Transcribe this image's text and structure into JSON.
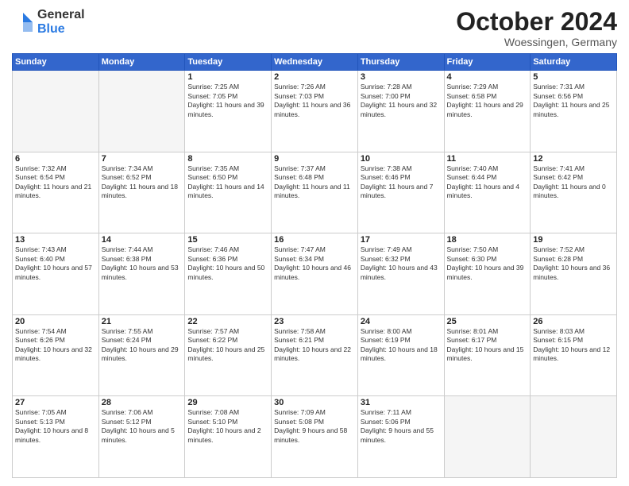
{
  "header": {
    "logo_general": "General",
    "logo_blue": "Blue",
    "month_title": "October 2024",
    "location": "Woessingen, Germany"
  },
  "weekdays": [
    "Sunday",
    "Monday",
    "Tuesday",
    "Wednesday",
    "Thursday",
    "Friday",
    "Saturday"
  ],
  "weeks": [
    [
      {
        "day": "",
        "empty": true
      },
      {
        "day": "",
        "empty": true
      },
      {
        "day": "1",
        "sunrise": "Sunrise: 7:25 AM",
        "sunset": "Sunset: 7:05 PM",
        "daylight": "Daylight: 11 hours and 39 minutes."
      },
      {
        "day": "2",
        "sunrise": "Sunrise: 7:26 AM",
        "sunset": "Sunset: 7:03 PM",
        "daylight": "Daylight: 11 hours and 36 minutes."
      },
      {
        "day": "3",
        "sunrise": "Sunrise: 7:28 AM",
        "sunset": "Sunset: 7:00 PM",
        "daylight": "Daylight: 11 hours and 32 minutes."
      },
      {
        "day": "4",
        "sunrise": "Sunrise: 7:29 AM",
        "sunset": "Sunset: 6:58 PM",
        "daylight": "Daylight: 11 hours and 29 minutes."
      },
      {
        "day": "5",
        "sunrise": "Sunrise: 7:31 AM",
        "sunset": "Sunset: 6:56 PM",
        "daylight": "Daylight: 11 hours and 25 minutes."
      }
    ],
    [
      {
        "day": "6",
        "sunrise": "Sunrise: 7:32 AM",
        "sunset": "Sunset: 6:54 PM",
        "daylight": "Daylight: 11 hours and 21 minutes."
      },
      {
        "day": "7",
        "sunrise": "Sunrise: 7:34 AM",
        "sunset": "Sunset: 6:52 PM",
        "daylight": "Daylight: 11 hours and 18 minutes."
      },
      {
        "day": "8",
        "sunrise": "Sunrise: 7:35 AM",
        "sunset": "Sunset: 6:50 PM",
        "daylight": "Daylight: 11 hours and 14 minutes."
      },
      {
        "day": "9",
        "sunrise": "Sunrise: 7:37 AM",
        "sunset": "Sunset: 6:48 PM",
        "daylight": "Daylight: 11 hours and 11 minutes."
      },
      {
        "day": "10",
        "sunrise": "Sunrise: 7:38 AM",
        "sunset": "Sunset: 6:46 PM",
        "daylight": "Daylight: 11 hours and 7 minutes."
      },
      {
        "day": "11",
        "sunrise": "Sunrise: 7:40 AM",
        "sunset": "Sunset: 6:44 PM",
        "daylight": "Daylight: 11 hours and 4 minutes."
      },
      {
        "day": "12",
        "sunrise": "Sunrise: 7:41 AM",
        "sunset": "Sunset: 6:42 PM",
        "daylight": "Daylight: 11 hours and 0 minutes."
      }
    ],
    [
      {
        "day": "13",
        "sunrise": "Sunrise: 7:43 AM",
        "sunset": "Sunset: 6:40 PM",
        "daylight": "Daylight: 10 hours and 57 minutes."
      },
      {
        "day": "14",
        "sunrise": "Sunrise: 7:44 AM",
        "sunset": "Sunset: 6:38 PM",
        "daylight": "Daylight: 10 hours and 53 minutes."
      },
      {
        "day": "15",
        "sunrise": "Sunrise: 7:46 AM",
        "sunset": "Sunset: 6:36 PM",
        "daylight": "Daylight: 10 hours and 50 minutes."
      },
      {
        "day": "16",
        "sunrise": "Sunrise: 7:47 AM",
        "sunset": "Sunset: 6:34 PM",
        "daylight": "Daylight: 10 hours and 46 minutes."
      },
      {
        "day": "17",
        "sunrise": "Sunrise: 7:49 AM",
        "sunset": "Sunset: 6:32 PM",
        "daylight": "Daylight: 10 hours and 43 minutes."
      },
      {
        "day": "18",
        "sunrise": "Sunrise: 7:50 AM",
        "sunset": "Sunset: 6:30 PM",
        "daylight": "Daylight: 10 hours and 39 minutes."
      },
      {
        "day": "19",
        "sunrise": "Sunrise: 7:52 AM",
        "sunset": "Sunset: 6:28 PM",
        "daylight": "Daylight: 10 hours and 36 minutes."
      }
    ],
    [
      {
        "day": "20",
        "sunrise": "Sunrise: 7:54 AM",
        "sunset": "Sunset: 6:26 PM",
        "daylight": "Daylight: 10 hours and 32 minutes."
      },
      {
        "day": "21",
        "sunrise": "Sunrise: 7:55 AM",
        "sunset": "Sunset: 6:24 PM",
        "daylight": "Daylight: 10 hours and 29 minutes."
      },
      {
        "day": "22",
        "sunrise": "Sunrise: 7:57 AM",
        "sunset": "Sunset: 6:22 PM",
        "daylight": "Daylight: 10 hours and 25 minutes."
      },
      {
        "day": "23",
        "sunrise": "Sunrise: 7:58 AM",
        "sunset": "Sunset: 6:21 PM",
        "daylight": "Daylight: 10 hours and 22 minutes."
      },
      {
        "day": "24",
        "sunrise": "Sunrise: 8:00 AM",
        "sunset": "Sunset: 6:19 PM",
        "daylight": "Daylight: 10 hours and 18 minutes."
      },
      {
        "day": "25",
        "sunrise": "Sunrise: 8:01 AM",
        "sunset": "Sunset: 6:17 PM",
        "daylight": "Daylight: 10 hours and 15 minutes."
      },
      {
        "day": "26",
        "sunrise": "Sunrise: 8:03 AM",
        "sunset": "Sunset: 6:15 PM",
        "daylight": "Daylight: 10 hours and 12 minutes."
      }
    ],
    [
      {
        "day": "27",
        "sunrise": "Sunrise: 7:05 AM",
        "sunset": "Sunset: 5:13 PM",
        "daylight": "Daylight: 10 hours and 8 minutes."
      },
      {
        "day": "28",
        "sunrise": "Sunrise: 7:06 AM",
        "sunset": "Sunset: 5:12 PM",
        "daylight": "Daylight: 10 hours and 5 minutes."
      },
      {
        "day": "29",
        "sunrise": "Sunrise: 7:08 AM",
        "sunset": "Sunset: 5:10 PM",
        "daylight": "Daylight: 10 hours and 2 minutes."
      },
      {
        "day": "30",
        "sunrise": "Sunrise: 7:09 AM",
        "sunset": "Sunset: 5:08 PM",
        "daylight": "Daylight: 9 hours and 58 minutes."
      },
      {
        "day": "31",
        "sunrise": "Sunrise: 7:11 AM",
        "sunset": "Sunset: 5:06 PM",
        "daylight": "Daylight: 9 hours and 55 minutes."
      },
      {
        "day": "",
        "empty": true
      },
      {
        "day": "",
        "empty": true
      }
    ]
  ]
}
